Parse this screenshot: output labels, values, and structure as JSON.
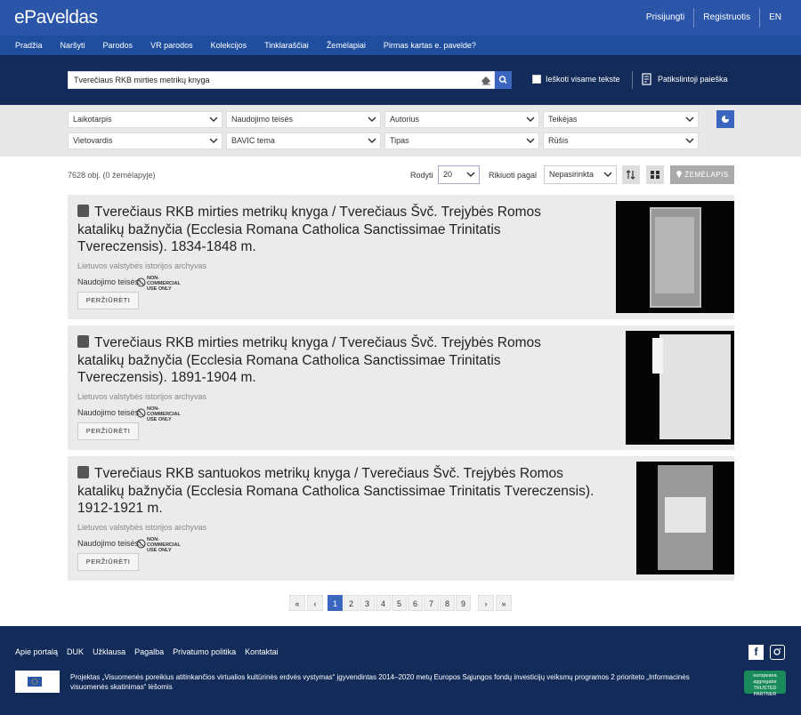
{
  "header": {
    "logo": "ePaveldas",
    "login": "Prisijungti",
    "register": "Registruotis",
    "lang": "EN"
  },
  "nav": [
    "Pradžia",
    "Naršyti",
    "Parodos",
    "VR parodos",
    "Kolekcijos",
    "Tinklaraščiai",
    "Žemėlapiai",
    "Pirmas kartas e. pavelde?"
  ],
  "search": {
    "value": "Tverečiaus RKB mirties metrikų knyga",
    "fulltext_label": "Ieškoti visame tekste",
    "advanced_label": "Patikslintoji paieška"
  },
  "filters": [
    "Laikotarpis",
    "Naudojimo teisės",
    "Autorius",
    "Teikėjas",
    "Vietovardis",
    "BAVIC tema",
    "Tipas",
    "Rūšis"
  ],
  "results_bar": {
    "count": "7628 obj. (0 žemėlapyje)",
    "show_label": "Rodyti",
    "show_value": "20",
    "sort_label": "Rikiuoti pagal",
    "sort_value": "Nepasirinkta",
    "map_button": "ŽEMĖLAPIS"
  },
  "results": [
    {
      "title": "Tverečiaus RKB mirties metrikų knyga / Tverečiaus Švč. Trejybės Romos katalikų bažnyčia (Ecclesia Romana Catholica Sanctissimae Trinitatis Tvereczensis). 1834-1848 m.",
      "org": "Lietuvos valstybės istorijos archyvas",
      "rights_label": "Naudojimo teisės:",
      "license": "NON-COMMERCIAL USE ONLY",
      "view": "PERŽIŪRĖTI"
    },
    {
      "title": "Tverečiaus RKB mirties metrikų knyga / Tverečiaus Švč. Trejybės Romos katalikų bažnyčia (Ecclesia Romana Catholica Sanctissimae Trinitatis Tvereczensis). 1891-1904 m.",
      "org": "Lietuvos valstybės istorijos archyvas",
      "rights_label": "Naudojimo teisės:",
      "license": "NON-COMMERCIAL USE ONLY",
      "view": "PERŽIŪRĖTI"
    },
    {
      "title": "Tverečiaus RKB santuokos metrikų knyga / Tverečiaus Švč. Trejybės Romos katalikų bažnyčia (Ecclesia Romana Catholica Sanctissimae Trinitatis Tvereczensis). 1912-1921 m.",
      "org": "Lietuvos valstybės istorijos archyvas",
      "rights_label": "Naudojimo teisės:",
      "license": "NON-COMMERCIAL USE ONLY",
      "view": "PERŽIŪRĖTI"
    }
  ],
  "pagination": {
    "first": "«",
    "prev": "‹",
    "pages": [
      "1",
      "2",
      "3",
      "4",
      "5",
      "6",
      "7",
      "8",
      "9"
    ],
    "current": "1",
    "next": "›",
    "last": "»"
  },
  "footer": {
    "links": [
      "Apie portalą",
      "DUK",
      "Užklausa",
      "Pagalba",
      "Privatumo politika",
      "Kontaktai"
    ],
    "text": "Projektas „Visuomenės poreikius atitinkančios virtualios kultūrinės erdvės vystymas“ įgyvendintas 2014–2020 metų Europos Sąjungos fondų investicijų veiksmų programos 2 prioriteto „Informacinės visuomenės skatinimas“ lėšomis",
    "badge": "europeana aggregator TRUSTED PARTNER"
  },
  "colors": {
    "header": "#2a55a8",
    "nav": "#204e9f",
    "search_bg": "#122b58",
    "accent": "#3a66bf",
    "footer": "#122b58"
  }
}
